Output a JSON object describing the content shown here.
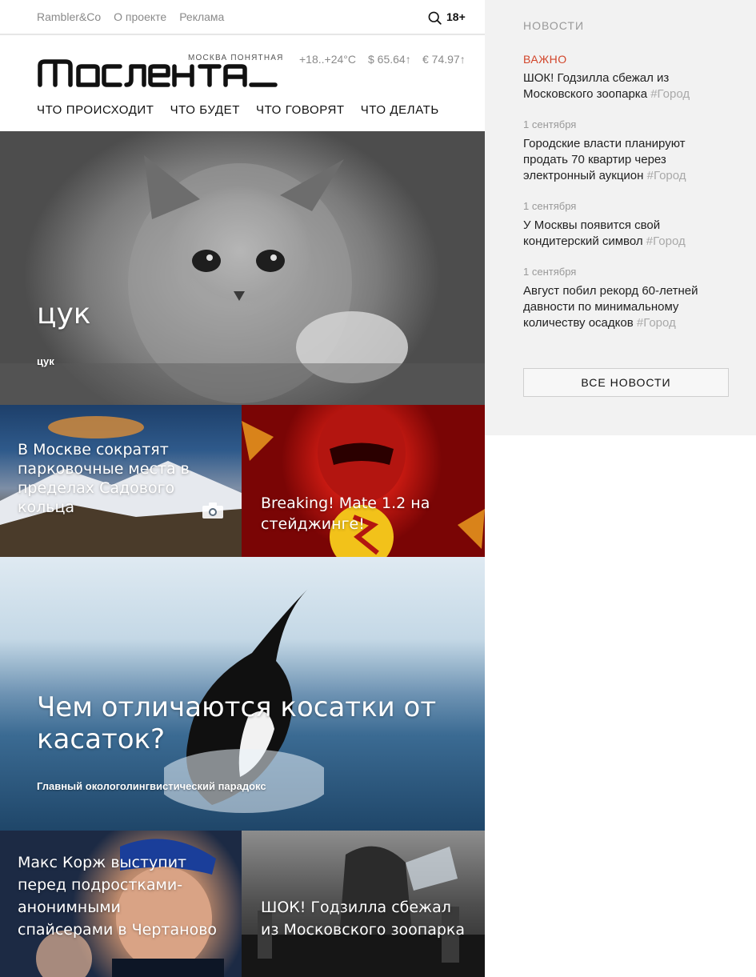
{
  "topbar": {
    "links": [
      "Rambler&Co",
      "О проекте",
      "Реклама"
    ],
    "age_badge": "18+",
    "search_icon": "search-icon"
  },
  "header": {
    "logo_text": "Мослента",
    "tagline": "МОСКВА ПОНЯТНАЯ",
    "weather": "+18..+24°C",
    "usd": "$ 65.64↑",
    "eur": "€ 74.97↑",
    "nav": [
      "ЧТО ПРОИСХОДИТ",
      "ЧТО БУДЕТ",
      "ЧТО ГОВОРЯТ",
      "ЧТО ДЕЛАТЬ"
    ]
  },
  "tiles": {
    "hero": {
      "title": "цук",
      "subtitle": "цук"
    },
    "parking": {
      "title": "В Москве сократят парковочные места в пределах Садового кольца",
      "icon": "camera-icon"
    },
    "mate": {
      "title": "Breaking! Mate 1.2 на стейджинге!"
    },
    "orca": {
      "title": "Чем отличаются косатки от касаток?",
      "subtitle": "Главный окологолингвистический парадокс"
    },
    "korzh": {
      "title": "Макс Корж выступит перед подростками-анонимными спайсерами в Чертаново"
    },
    "godzilla": {
      "title": "ШОК! Годзилла сбежал из Московского зоопарка"
    }
  },
  "sidebar": {
    "heading": "НОВОСТИ",
    "items": [
      {
        "date": "ВАЖНО",
        "text": "ШОК! Годзилла сбежал из Московского зоопарка",
        "tag": "#Город"
      },
      {
        "date": "1 сентября",
        "text": "Городские власти планируют продать 70 квартир через электронный аукцион",
        "tag": "#Город"
      },
      {
        "date": "1 сентября",
        "text": "У Москвы появится свой кондитерский символ",
        "tag": "#Город"
      },
      {
        "date": "1 сентября",
        "text": "Август побил рекорд 60-летней давности по минимальному количеству осадков",
        "tag": "#Город"
      }
    ],
    "all_news_button": "ВСЕ НОВОСТИ"
  },
  "colors": {
    "accent_important": "#d2452a",
    "sidebar_bg": "#f2f2f2",
    "muted_text": "#8a8a8a"
  }
}
